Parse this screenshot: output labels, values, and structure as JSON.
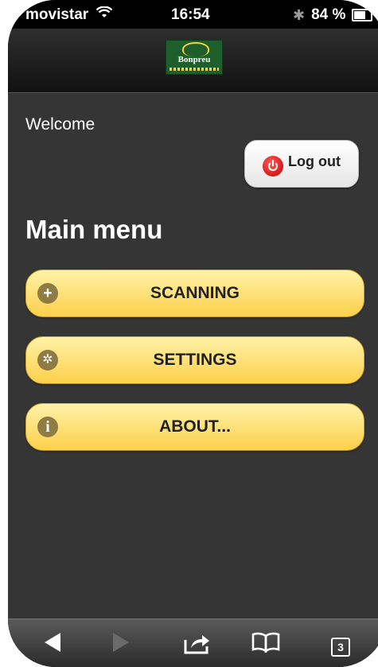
{
  "status_bar": {
    "carrier": "movistar",
    "time": "16:54",
    "battery": "84 %",
    "wifi_icon": "wifi-icon",
    "bluetooth_icon": "bluetooth-icon"
  },
  "header": {
    "logo_text": "Bonpreu"
  },
  "welcome_text": "Welcome",
  "logout": {
    "label": "Log out",
    "icon": "power-icon"
  },
  "menu": {
    "title": "Main menu",
    "items": [
      {
        "label": "SCANNING",
        "icon": "plus-icon",
        "glyph": "+"
      },
      {
        "label": "SETTINGS",
        "icon": "gear-icon",
        "glyph": "✲"
      },
      {
        "label": "ABOUT...",
        "icon": "info-icon",
        "glyph": "i"
      }
    ]
  },
  "toolbar": {
    "back_icon": "back-arrow-icon",
    "forward_icon": "forward-arrow-icon",
    "share_icon": "share-icon",
    "bookmarks_icon": "bookmarks-icon",
    "tabs_count": "3"
  },
  "colors": {
    "background": "#353535",
    "button_top": "#fff2a8",
    "button_bottom": "#fcd04a",
    "logo_green": "#1d5e2a"
  }
}
